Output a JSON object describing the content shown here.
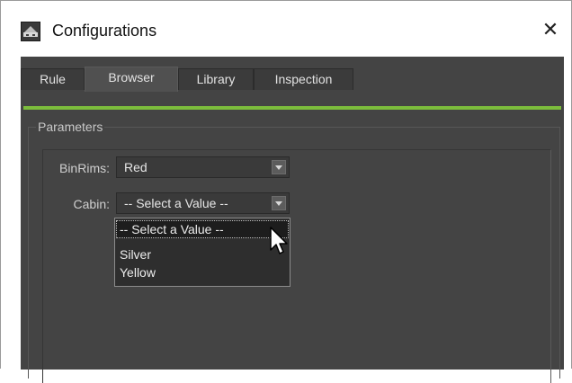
{
  "window": {
    "title": "Configurations",
    "close_glyph": "✕",
    "app_icon": "configurations-app-icon"
  },
  "tabs": [
    {
      "label": "Rule",
      "active": false
    },
    {
      "label": "Browser",
      "active": true
    },
    {
      "label": "Library",
      "active": false
    },
    {
      "label": "Inspection",
      "active": false
    }
  ],
  "panel": {
    "legend": "Parameters",
    "fields": [
      {
        "label": "BinRims:",
        "value": "Red"
      },
      {
        "label": "Cabin:",
        "value": "-- Select a Value --"
      }
    ]
  },
  "dropdown": {
    "options": [
      "-- Select a Value --",
      "Silver",
      "Yellow"
    ],
    "highlighted": "-- Select a Value --"
  },
  "colors": {
    "accent": "#7cbd3c",
    "background": "#444444"
  }
}
